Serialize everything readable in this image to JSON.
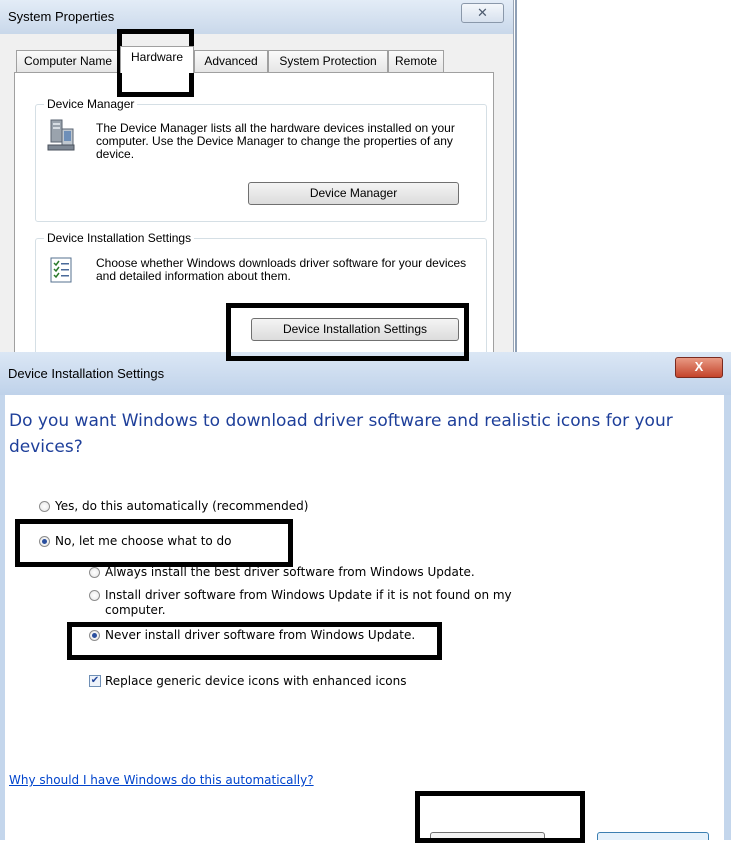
{
  "system_properties": {
    "title": "System Properties",
    "close_glyph": "✕",
    "tabs": [
      {
        "label": "Computer Name",
        "active": false
      },
      {
        "label": "Hardware",
        "active": true
      },
      {
        "label": "Advanced",
        "active": false
      },
      {
        "label": "System Protection",
        "active": false
      },
      {
        "label": "Remote",
        "active": false
      }
    ],
    "device_manager": {
      "group_label": "Device Manager",
      "icon": "computer-icon",
      "description": "The Device Manager lists all the hardware devices installed on your computer. Use the Device Manager to change the properties of any device.",
      "button_label": "Device Manager"
    },
    "device_installation": {
      "group_label": "Device Installation Settings",
      "icon": "checklist-icon",
      "description": "Choose whether Windows downloads driver software for your devices and detailed information about them.",
      "button_label": "Device Installation Settings"
    }
  },
  "dialog": {
    "title": "Device Installation Settings",
    "close_glyph": "X",
    "question": "Do you want Windows to download driver software and realistic icons for your devices?",
    "options": [
      {
        "label": "Yes, do this automatically (recommended)",
        "checked": false
      },
      {
        "label": "No, let me choose what to do",
        "checked": true
      }
    ],
    "sub_options": [
      {
        "label": "Always install the best driver software from Windows Update.",
        "checked": false
      },
      {
        "label": "Install driver software from Windows Update if it is not found on my computer.",
        "checked": false
      },
      {
        "label": "Never install driver software from Windows Update.",
        "checked": true
      }
    ],
    "replace_icons": {
      "label": "Replace generic device icons with enhanced icons",
      "checked": true
    },
    "help_link": "Why should I have Windows do this automatically?"
  },
  "colors": {
    "question_text": "#1e3f9a",
    "link": "#0044cc",
    "annotation_box": "#000000",
    "close_button": "#c4442b"
  }
}
